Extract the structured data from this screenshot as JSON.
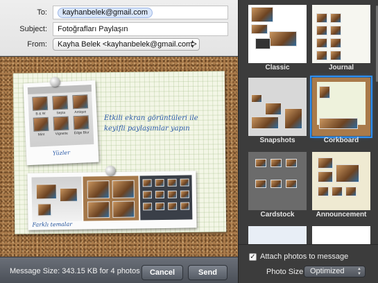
{
  "compose": {
    "to_label": "To:",
    "to_value": "kayhanbelek@gmail.com",
    "subject_label": "Subject:",
    "subject_value": "Fotoğrafları Paylaşın",
    "from_label": "From:",
    "from_value": "Kayha Belek <kayhanbelek@gmail.com>"
  },
  "stationery": {
    "tile_labels": [
      "B & W",
      "Sepia",
      "Antique",
      "Mint",
      "Vignette",
      "Edge Blur"
    ],
    "handwriting": "Etkili ekran görüntüleri ile keyifli paylaşımlar yapın",
    "caption1": "Yüzler",
    "caption2": "Farklı temalar"
  },
  "footer": {
    "message_size": "Message Size: 343.15 KB for 4 photos",
    "cancel": "Cancel",
    "send": "Send"
  },
  "templates": {
    "items": [
      {
        "label": "Classic"
      },
      {
        "label": "Journal"
      },
      {
        "label": "Snapshots"
      },
      {
        "label": "Corkboard"
      },
      {
        "label": "Cardstock"
      },
      {
        "label": "Announcement"
      }
    ],
    "selected": "Corkboard"
  },
  "options": {
    "attach_label": "Attach photos to message",
    "attach_checked": true,
    "photo_size_label": "Photo Size:",
    "photo_size_value": "Optimized"
  },
  "colors": {
    "selection": "#2f8ff0",
    "cork": "#a97a4a",
    "handwriting": "#2a5aa8"
  }
}
